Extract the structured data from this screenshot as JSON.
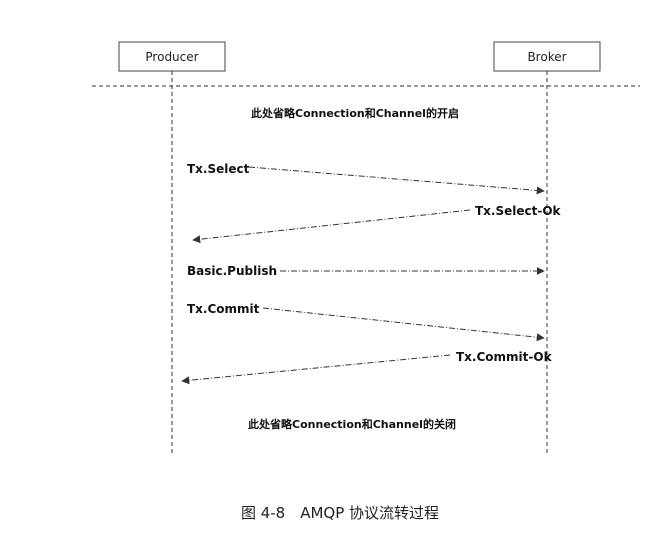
{
  "participants": {
    "producer": "Producer",
    "broker": "Broker"
  },
  "notes": {
    "open": "此处省略Connection和Channel的开启",
    "close": "此处省略Connection和Channel的关闭"
  },
  "messages": [
    {
      "label": "Tx.Select",
      "from": "producer",
      "to": "broker"
    },
    {
      "label": "Tx.Select-Ok",
      "from": "broker",
      "to": "producer"
    },
    {
      "label": "Basic.Publish",
      "from": "producer",
      "to": "broker"
    },
    {
      "label": "Tx.Commit",
      "from": "producer",
      "to": "broker"
    },
    {
      "label": "Tx.Commit-Ok",
      "from": "broker",
      "to": "producer"
    }
  ],
  "caption": "图 4-8　AMQP 协议流转过程",
  "colors": {
    "line": "#333333",
    "text": "#111111",
    "background": "#ffffff"
  }
}
